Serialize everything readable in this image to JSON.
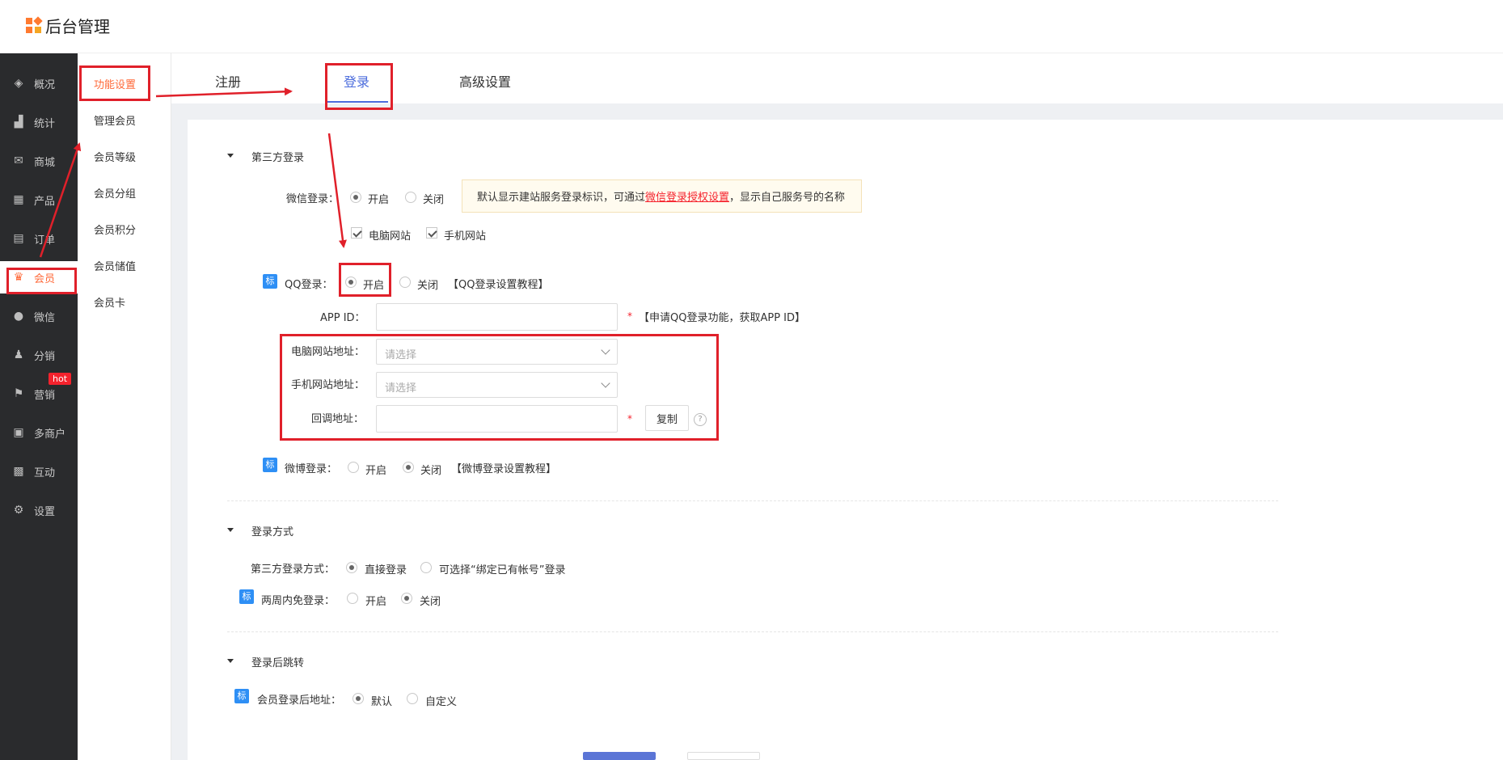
{
  "header": {
    "title": "后台管理"
  },
  "colors": {
    "accent": "#ff6a3a",
    "primary": "#4a6bdc",
    "annotation": "#e0202a",
    "badge": "#2e8ff5"
  },
  "sidebar": {
    "items": [
      {
        "label": "概况",
        "icon": "layers-icon"
      },
      {
        "label": "统计",
        "icon": "chart-icon"
      },
      {
        "label": "商城",
        "icon": "store-icon"
      },
      {
        "label": "产品",
        "icon": "grid-icon"
      },
      {
        "label": "订单",
        "icon": "order-icon"
      },
      {
        "label": "会员",
        "icon": "crown-icon"
      },
      {
        "label": "微信",
        "icon": "wechat-icon"
      },
      {
        "label": "分销",
        "icon": "user-share-icon"
      },
      {
        "label": "营销",
        "icon": "flag-icon"
      },
      {
        "label": "多商户",
        "icon": "merchant-icon"
      },
      {
        "label": "互动",
        "icon": "interact-icon"
      },
      {
        "label": "设置",
        "icon": "gear-icon"
      }
    ],
    "hot_badge": "hot"
  },
  "submenu": {
    "items": [
      "功能设置",
      "管理会员",
      "会员等级",
      "会员分组",
      "会员积分",
      "会员储值",
      "会员卡"
    ]
  },
  "tabs": [
    "注册",
    "登录",
    "高级设置"
  ],
  "sections": {
    "third_party": {
      "title": "第三方登录",
      "wechat_label": "微信登录：",
      "on": "开启",
      "off": "关闭",
      "tip_prefix": "默认显示建站服务登录标识，可通过",
      "tip_link": "微信登录授权设置",
      "tip_suffix": "，显示自己服务号的名称",
      "pc_site": "电脑网站",
      "mobile_site": "手机网站",
      "qq_badge": "标",
      "qq_label": "QQ登录：",
      "qq_tutorial": "【QQ登录设置教程】",
      "appid_label": "APP ID：",
      "appid_required": "*",
      "appid_note": "【申请QQ登录功能，获取APP ID】",
      "pc_url_label": "电脑网站地址：",
      "mobile_url_label": "手机网站地址：",
      "select_placeholder": "请选择",
      "callback_label": "回调地址：",
      "callback_required": "*",
      "copy_button": "复制",
      "help": "?",
      "weibo_badge": "标",
      "weibo_label": "微博登录：",
      "weibo_tutorial": "【微博登录设置教程】"
    },
    "login_method": {
      "title": "登录方式",
      "method_label": "第三方登录方式：",
      "direct": "直接登录",
      "bind": "可选择“绑定已有帐号”登录",
      "free_badge": "标",
      "free_label": "两周内免登录：",
      "on": "开启",
      "off": "关闭"
    },
    "redirect": {
      "title": "登录后跳转",
      "badge": "标",
      "label": "会员登录后地址：",
      "default": "默认",
      "custom": "自定义"
    }
  }
}
